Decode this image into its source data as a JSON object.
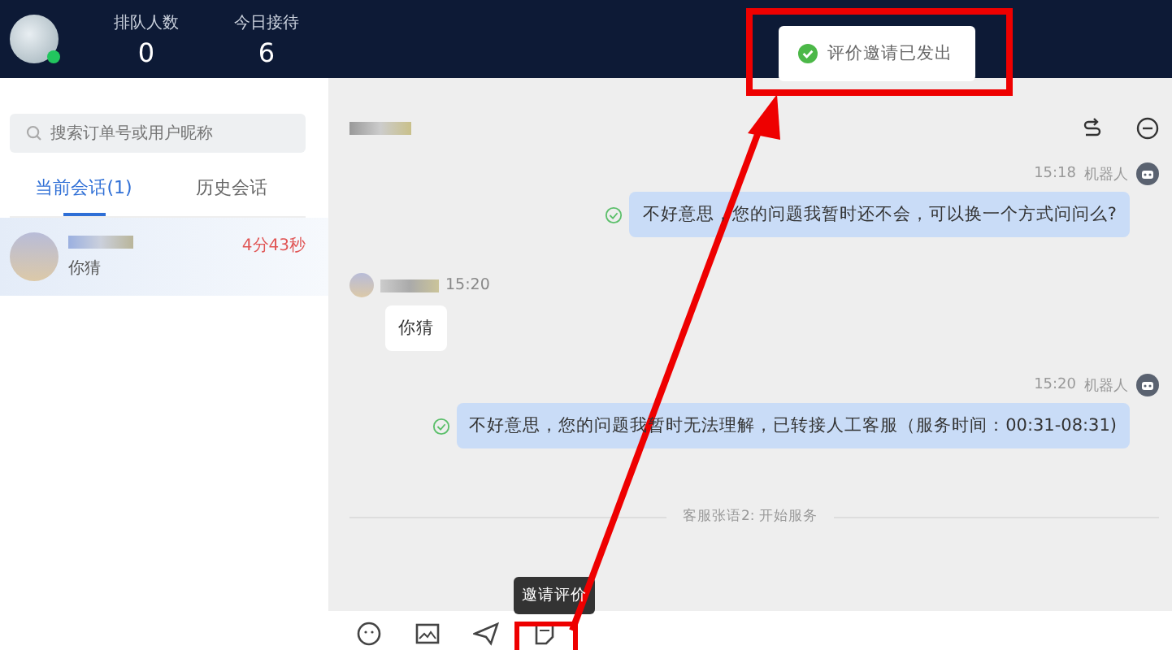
{
  "header": {
    "stats": [
      {
        "label": "排队人数",
        "value": "0"
      },
      {
        "label": "今日接待",
        "value": "6"
      }
    ]
  },
  "toast": {
    "text": "评价邀请已发出"
  },
  "sidebar": {
    "search": {
      "placeholder": "搜索订单号或用户昵称"
    },
    "tabs": [
      {
        "label": "当前会话(1)",
        "selected": true
      },
      {
        "label": "历史会话",
        "selected": false
      }
    ],
    "sessions": [
      {
        "preview": "你猜",
        "timer": "4分43秒",
        "selected": true
      }
    ]
  },
  "chat": {
    "messages": [
      {
        "kind": "robot",
        "time": "15:18",
        "sender": "机器人",
        "text": "不好意思，您的问题我暂时还不会，可以换一个方式问问么?"
      },
      {
        "kind": "user",
        "time": "15:20",
        "text": "你猜"
      },
      {
        "kind": "robot",
        "time": "15:20",
        "sender": "机器人",
        "text": "不好意思，您的问题我暂时无法理解，已转接人工客服（服务时间：00:31-08:31)"
      }
    ],
    "notice": "客服张语2: 开始服务",
    "toolbar": [
      {
        "kind": "emoji"
      },
      {
        "kind": "image"
      },
      {
        "kind": "send"
      },
      {
        "kind": "rate",
        "tooltip": "邀请评价"
      }
    ]
  }
}
